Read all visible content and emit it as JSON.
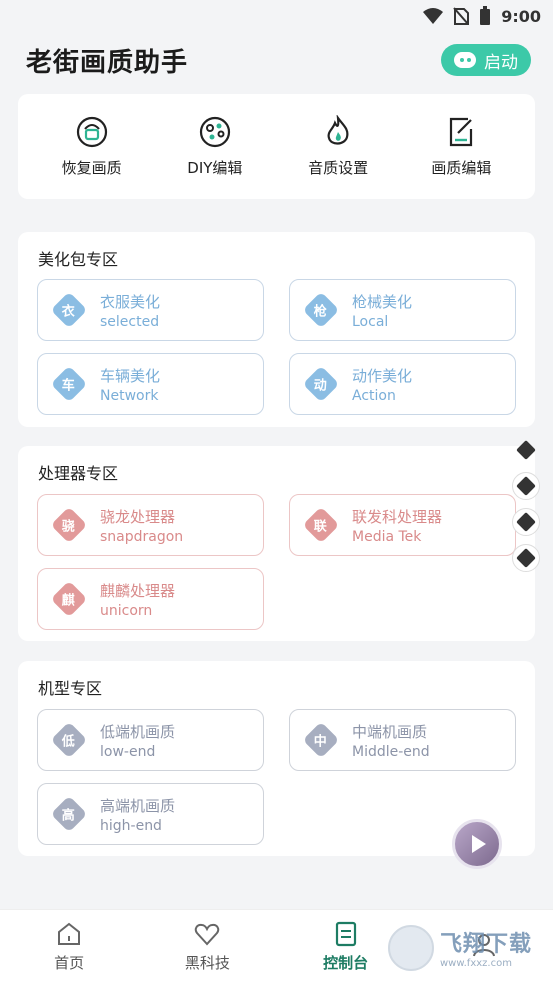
{
  "status_bar": {
    "time": "9:00"
  },
  "header": {
    "title": "老街画质助手",
    "start_button": "启动"
  },
  "quick_actions": [
    {
      "label": "恢复画质",
      "icon": "restore-icon"
    },
    {
      "label": "DIY编辑",
      "icon": "palette-icon"
    },
    {
      "label": "音质设置",
      "icon": "flame-icon"
    },
    {
      "label": "画质编辑",
      "icon": "edit-icon"
    }
  ],
  "sections": {
    "beautify": {
      "title": "美化包专区",
      "items": [
        {
          "badge": "衣",
          "name": "衣服美化",
          "sub": "selected"
        },
        {
          "badge": "枪",
          "name": "枪械美化",
          "sub": "Local"
        },
        {
          "badge": "车",
          "name": "车辆美化",
          "sub": "Network"
        },
        {
          "badge": "动",
          "name": "动作美化",
          "sub": "Action"
        }
      ]
    },
    "processor": {
      "title": "处理器专区",
      "items": [
        {
          "badge": "骁",
          "name": "骁龙处理器",
          "sub": "snapdragon"
        },
        {
          "badge": "联",
          "name": "联发科处理器",
          "sub": "Media Tek"
        },
        {
          "badge": "麒",
          "name": "麒麟处理器",
          "sub": "unicorn"
        }
      ]
    },
    "model": {
      "title": "机型专区",
      "items": [
        {
          "badge": "低",
          "name": "低端机画质",
          "sub": "low-end"
        },
        {
          "badge": "中",
          "name": "中端机画质",
          "sub": "Middle-end"
        },
        {
          "badge": "高",
          "name": "高端机画质",
          "sub": "high-end"
        }
      ]
    }
  },
  "tabs": [
    {
      "label": "首页",
      "icon": "home-icon"
    },
    {
      "label": "黑科技",
      "icon": "heart-icon"
    },
    {
      "label": "控制台",
      "icon": "document-icon",
      "active": true
    },
    {
      "label": "",
      "icon": "profile-icon"
    }
  ],
  "watermark": {
    "main": "飞翔下载",
    "sub": "www.fxxz.com"
  },
  "colors": {
    "accent": "#3cc9a8",
    "blue_tile": "#7aaed8",
    "red_tile": "#d98a8a",
    "gray_tile": "#8c94a8",
    "active_tab": "#1d7c63"
  }
}
